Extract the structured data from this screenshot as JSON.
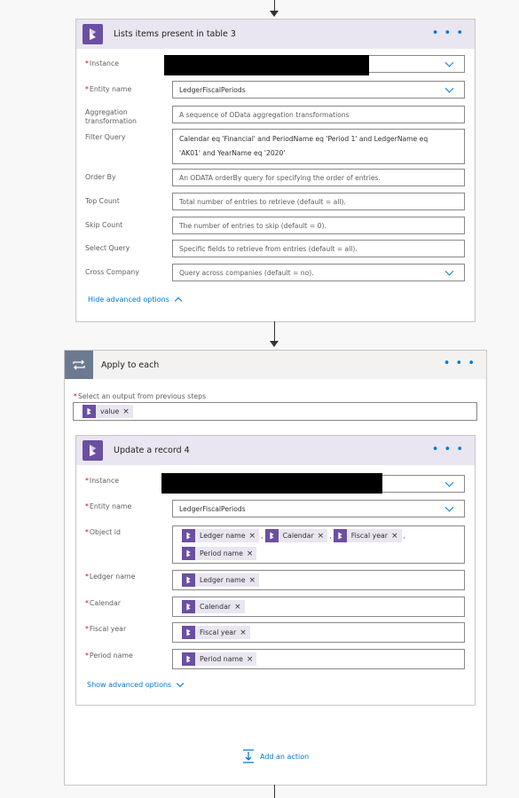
{
  "list_card": {
    "title": "Lists items present in table 3",
    "more": "• • •",
    "fields": {
      "instance": {
        "label": "Instance"
      },
      "entity": {
        "label": "Entity name",
        "value": "LedgerFiscalPeriods"
      },
      "aggregation": {
        "label": "Aggregation transformation",
        "placeholder": "A sequence of OData aggregation transformations"
      },
      "filter": {
        "label": "Filter Query",
        "line1": "Calendar eq 'Financial' and PeriodName eq 'Period 1' and LedgerName eq",
        "line2": "'AK01' and YearName eq '2020'"
      },
      "orderby": {
        "label": "Order By",
        "placeholder": "An ODATA orderBy query for specifying the order of entries."
      },
      "top": {
        "label": "Top Count",
        "placeholder": "Total number of entries to retrieve (default = all)."
      },
      "skip": {
        "label": "Skip Count",
        "placeholder": "The number of entries to skip (default = 0)."
      },
      "select": {
        "label": "Select Query",
        "placeholder": "Specific fields to retrieve from entries (default = all)."
      },
      "cross": {
        "label": "Cross Company",
        "placeholder": "Query across companies (default = no)."
      }
    },
    "toggle": "Hide advanced options"
  },
  "apply_card": {
    "title": "Apply to each",
    "more": "• • •",
    "output_label": "Select an output from previous steps",
    "output_token": "value"
  },
  "update_card": {
    "title": "Update a record 4",
    "more": "• • •",
    "fields": {
      "instance": {
        "label": "Instance"
      },
      "entity": {
        "label": "Entity name",
        "value": "LedgerFiscalPeriods"
      },
      "object_id": {
        "label": "Object id",
        "tokens": [
          "Ledger name",
          "Calendar",
          "Fiscal year",
          "Period name"
        ],
        "separator": ","
      },
      "ledger": {
        "label": "Ledger name",
        "token": "Ledger name"
      },
      "calendar": {
        "label": "Calendar",
        "token": "Calendar"
      },
      "fiscal": {
        "label": "Fiscal year",
        "token": "Fiscal year"
      },
      "period": {
        "label": "Period name",
        "token": "Period name"
      }
    },
    "toggle": "Show advanced options"
  },
  "add_action": "Add an action",
  "colors": {
    "accent": "#0078d4",
    "tile": "#6b4fa1",
    "required": "#c50f1f"
  }
}
